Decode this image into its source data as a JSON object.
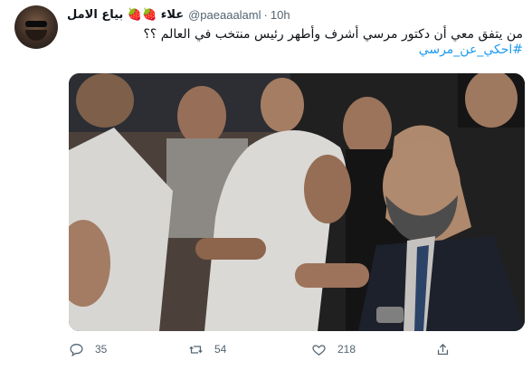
{
  "tweet": {
    "author_name": "علاء 🍓🍓 بياع الامل",
    "handle": "@paeaaalaml",
    "time": "10h",
    "text": "من يتفق معي أن دكتور مرسي أشرف وأطهر رئيس منتخب في العالم ؟؟",
    "hashtag": "#احكي_عن_مرسي"
  },
  "actions": {
    "replies": "35",
    "retweets": "54",
    "likes": "218"
  },
  "icons": {
    "reply": "reply-icon",
    "retweet": "retweet-icon",
    "like": "heart-icon",
    "share": "share-icon"
  }
}
